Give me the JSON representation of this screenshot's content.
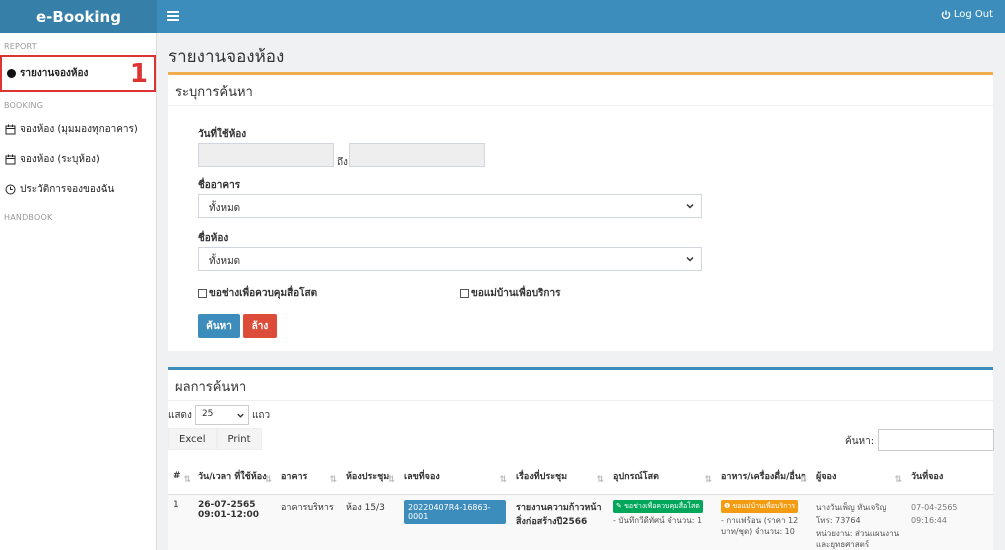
{
  "app": {
    "brand": "e-Booking",
    "logout_label": "Log Out"
  },
  "sidebar": {
    "sections": [
      {
        "header": "REPORT",
        "items": [
          {
            "label": "รายงานจองห้อง",
            "active": true,
            "marker": "1"
          }
        ]
      },
      {
        "header": "BOOKING",
        "items": [
          {
            "label": "จองห้อง (มุมมองทุกอาคาร)"
          },
          {
            "label": "จองห้อง (ระบุห้อง)"
          },
          {
            "label": "ประวัติการจองของฉัน"
          }
        ]
      },
      {
        "header": "HANDBOOK",
        "items": []
      }
    ]
  },
  "page": {
    "title": "รายงานจองห้อง"
  },
  "search": {
    "title": "ระบุการค้นหา",
    "date_label": "วันที่ใช้ห้อง",
    "to_label": "ถึง",
    "building_label": "ชื่ออาคาร",
    "building_value": "ทั้งหมด",
    "room_label": "ชื่อห้อง",
    "room_value": "ทั้งหมด",
    "check_av": "ขอช่างเพื่อควบคุมสื่อโสต",
    "check_maid": "ขอแม่บ้านเพื่อบริการ",
    "search_button": "ค้นหา",
    "clear_button": "ล้าง"
  },
  "result": {
    "title": "ผลการค้นหา",
    "show_label": "แสดง",
    "show_value": "25",
    "rows_label": "แถว",
    "excel": "Excel",
    "print": "Print",
    "search_label": "ค้นหา:",
    "columns": [
      "#",
      "วัน/เวลา ที่ใช้ห้อง",
      "อาคาร",
      "ห้องประชุม",
      "เลขที่จอง",
      "เรื่องที่ประชุม",
      "อุปกรณ์โสต",
      "อาหาร/เครื่องดื่ม/อื่นๆ",
      "ผู้จอง",
      "วันที่จอง"
    ],
    "rows": [
      {
        "no": "1",
        "date": "26-07-2565",
        "time": "09:01-12:00",
        "building": "อาคารบริหาร",
        "room": "ห้อง 15/3",
        "booking_no": "20220407R4-16863-0001",
        "topic": "รายงานความก้าวหน้าสิ่งก่อสร้างปี2566",
        "equip_tag": "ขอช่างเพื่อควบคุมสื่อโสต",
        "equip_detail": "- บันทึกวีดีทัศน์ จำนวน: 1",
        "food_tag": "ขอแม่บ้านเพื่อบริการ",
        "food_detail": "- กาแฟร้อน (ราคา 12 บาท/ชุด) จำนวน: 10",
        "booker_name": "นางวันเพ็ญ ทันเจริญ",
        "booker_phone": "โทร: 73764",
        "booker_unit": "หน่วยงาน: ส่วนแผนงานและยุทธศาสตร์",
        "booked_date": "07-04-2565",
        "booked_time": "09:16:44"
      }
    ]
  },
  "colors": {
    "header_bg": "#3c8dbc",
    "brand_bg": "#367fa9",
    "accent_red": "#dd4b39",
    "success": "#00a65a",
    "warning": "#f39c12"
  }
}
